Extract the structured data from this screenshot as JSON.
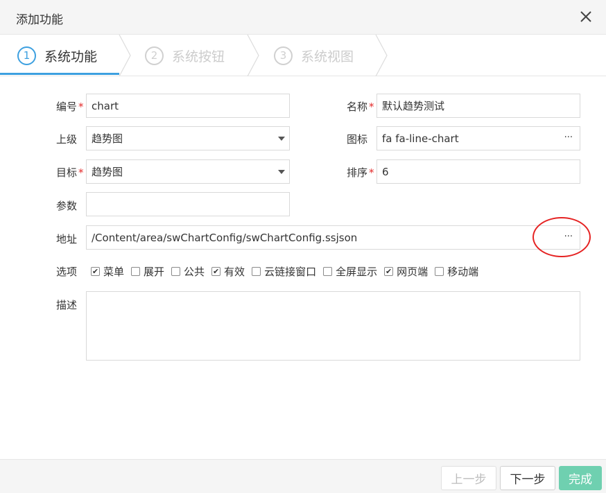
{
  "dialog": {
    "title": "添加功能"
  },
  "steps": [
    {
      "num": "1",
      "label": "系统功能"
    },
    {
      "num": "2",
      "label": "系统按钮"
    },
    {
      "num": "3",
      "label": "系统视图"
    }
  ],
  "form": {
    "code": {
      "label": "编号",
      "value": "chart"
    },
    "name": {
      "label": "名称",
      "value": "默认趋势测试"
    },
    "parent": {
      "label": "上级",
      "value": "趋势图"
    },
    "icon": {
      "label": "图标",
      "value": "fa fa-line-chart",
      "button": "···"
    },
    "target": {
      "label": "目标",
      "value": "趋势图"
    },
    "order": {
      "label": "排序",
      "value": "6"
    },
    "params": {
      "label": "参数",
      "value": ""
    },
    "url": {
      "label": "地址",
      "value": "/Content/area/swChartConfig/swChartConfig.ssjson",
      "button": "···"
    },
    "options_label": "选项",
    "description": {
      "label": "描述",
      "value": ""
    },
    "required_mark": "*"
  },
  "options": [
    {
      "label": "菜单",
      "checked": true
    },
    {
      "label": "展开",
      "checked": false
    },
    {
      "label": "公共",
      "checked": false
    },
    {
      "label": "有效",
      "checked": true
    },
    {
      "label": "云链接窗口",
      "checked": false
    },
    {
      "label": "全屏显示",
      "checked": false
    },
    {
      "label": "网页端",
      "checked": true
    },
    {
      "label": "移动端",
      "checked": false
    }
  ],
  "footer": {
    "prev": "上一步",
    "next": "下一步",
    "done": "完成"
  },
  "colors": {
    "accent": "#3da0e0",
    "done": "#6fd0b0",
    "required": "#e32b2b",
    "annotation": "#e52222"
  }
}
